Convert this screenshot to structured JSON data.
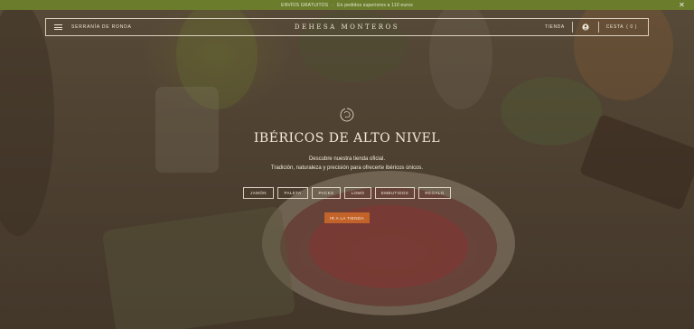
{
  "promo": {
    "lead": "ENVÍOS GRATUITOS",
    "sep": "·",
    "text": "En pedidos superiores a 110 euros",
    "close_glyph": "✕"
  },
  "header": {
    "menu_icon": "hamburger-icon",
    "region": "SERRANÍA DE RONDA",
    "brand": "DEHESA MONTEROS",
    "shop": "TIENDA",
    "account_icon": "user-icon",
    "cart_label": "CESTA",
    "cart_count": "( 0 )"
  },
  "hero": {
    "badge_icon": "brand-badge-icon",
    "title": "IBÉRICOS DE ALTO NIVEL",
    "subtitle_1": "Descubre nuestra tienda oficial.",
    "subtitle_2": "Tradición, naturaleza y precisión para ofrecerte ibéricos únicos.",
    "categories": [
      "JAMÓN",
      "PALETA",
      "PACKS",
      "LOMO",
      "EMBUTIDOS",
      "REGALO"
    ],
    "cta": "IR A LA TIENDA"
  },
  "colors": {
    "promo_bg": "#6b7c2c",
    "cta_bg": "#c2632a",
    "text_light": "#f3ead9"
  }
}
